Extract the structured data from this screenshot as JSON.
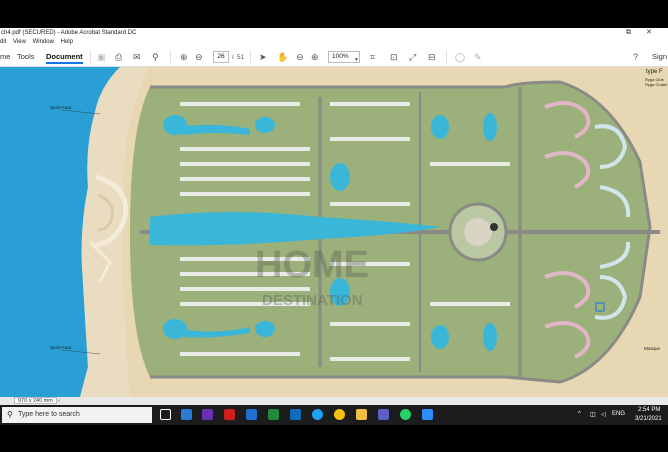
{
  "window": {
    "title": "ch4.pdf (SECURED) - Adobe Acrobat Standard DC",
    "minimize": "–",
    "restore": "⧉",
    "close": "✕"
  },
  "menu": [
    "dit",
    "View",
    "Window",
    "Help"
  ],
  "toolbar": {
    "tabs": [
      "me",
      "Tools",
      "Document"
    ],
    "active_tab": "Document",
    "page_current": "26",
    "page_sep": "/",
    "page_total": "51",
    "zoom": "100%",
    "sign": "Sign"
  },
  "map": {
    "watermark_line1": "HOME",
    "watermark_line2": "DESTINATION",
    "labels": {
      "sport_area_top": "Sport Area",
      "sport_area_bottom": "Sport Area",
      "mosque": "Mosque",
      "type": "type F",
      "legend_1": "Ryga Club",
      "legend_2": "Ryga Chalet"
    }
  },
  "statusbar": {
    "dimensions": "970 x 240 mm"
  },
  "taskbar": {
    "search_placeholder": "Type here to search",
    "lang": "ENG",
    "time": "2:54 PM",
    "date": "3/21/2021"
  },
  "colors": {
    "sea": "#2a9fd6",
    "sand": "#e7d7b3",
    "land": "#9bb07a",
    "road": "#8a8a86",
    "pool": "#3ab6d8",
    "accent": "#1473e6"
  }
}
